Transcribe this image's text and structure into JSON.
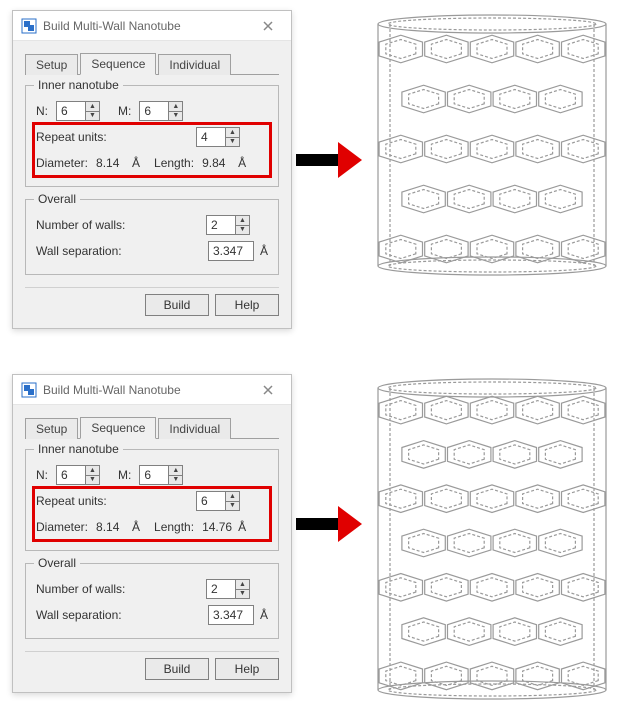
{
  "dialog": {
    "title": "Build Multi-Wall Nanotube",
    "tabs": {
      "setup": "Setup",
      "sequence": "Sequence",
      "individual": "Individual"
    },
    "inner_group": {
      "legend": "Inner nanotube",
      "n_label": "N:",
      "m_label": "M:",
      "repeat_label": "Repeat units:",
      "diameter_label": "Diameter:",
      "length_label": "Length:"
    },
    "overall_group": {
      "legend": "Overall",
      "walls_label": "Number of walls:",
      "sep_label": "Wall separation:"
    },
    "buttons": {
      "build": "Build",
      "help": "Help"
    },
    "unit_angstrom": "Å"
  },
  "panels": [
    {
      "n": "6",
      "m": "6",
      "repeat": "4",
      "diameter": "8.14",
      "length": "9.84",
      "walls": "2",
      "sep": "3.347",
      "tube_rings": 5
    },
    {
      "n": "6",
      "m": "6",
      "repeat": "6",
      "diameter": "8.14",
      "length": "14.76",
      "walls": "2",
      "sep": "3.347",
      "tube_rings": 7
    }
  ],
  "colors": {
    "highlight": "#e00000"
  }
}
